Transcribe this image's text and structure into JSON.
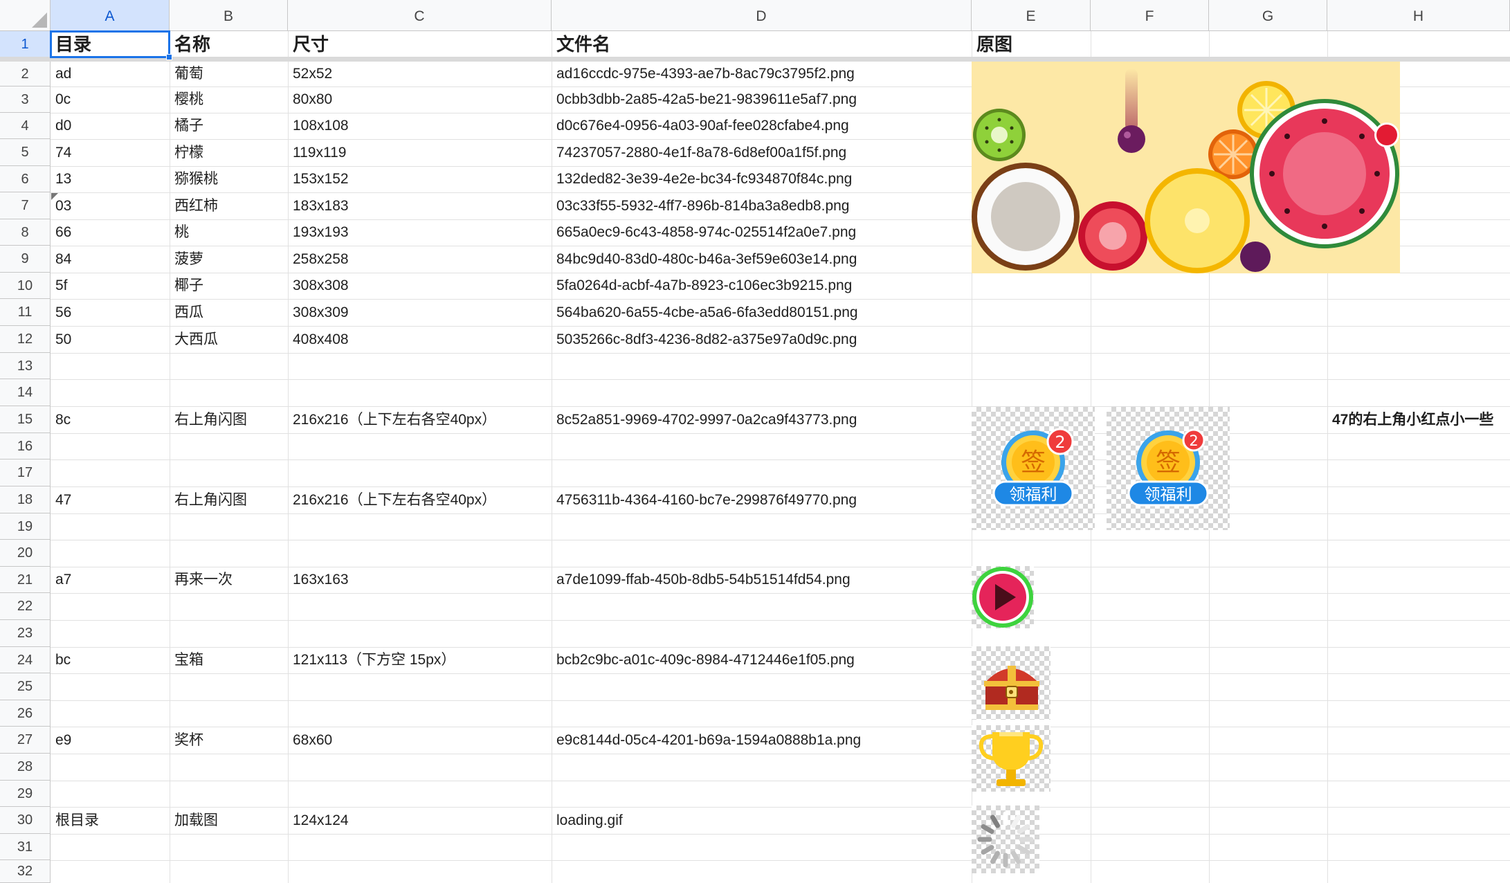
{
  "columns": [
    "A",
    "B",
    "C",
    "D",
    "E",
    "F",
    "G",
    "H"
  ],
  "rows": [
    "1",
    "2",
    "3",
    "4",
    "5",
    "6",
    "7",
    "8",
    "9",
    "10",
    "11",
    "12",
    "13",
    "14",
    "15",
    "16",
    "17",
    "18",
    "19",
    "20",
    "21",
    "22",
    "23",
    "24",
    "25",
    "26",
    "27",
    "28",
    "29",
    "30",
    "31",
    "32"
  ],
  "header": {
    "dir": "目录",
    "name": "名称",
    "size": "尺寸",
    "file": "文件名",
    "orig": "原图"
  },
  "fruits": [
    {
      "dir": "ad",
      "name": "葡萄",
      "size": "52x52",
      "file": "ad16ccdc-975e-4393-ae7b-8ac79c3795f2.png"
    },
    {
      "dir": "0c",
      "name": "樱桃",
      "size": "80x80",
      "file": "0cbb3dbb-2a85-42a5-be21-9839611e5af7.png"
    },
    {
      "dir": "d0",
      "name": "橘子",
      "size": "108x108",
      "file": "d0c676e4-0956-4a03-90af-fee028cfabe4.png"
    },
    {
      "dir": "74",
      "name": "柠檬",
      "size": "119x119",
      "file": "74237057-2880-4e1f-8a78-6d8ef00a1f5f.png"
    },
    {
      "dir": "13",
      "name": "猕猴桃",
      "size": "153x152",
      "file": "132ded82-3e39-4e2e-bc34-fc934870f84c.png"
    },
    {
      "dir": "03",
      "name": "西红柿",
      "size": "183x183",
      "file": "03c33f55-5932-4ff7-896b-814ba3a8edb8.png"
    },
    {
      "dir": "66",
      "name": "桃",
      "size": "193x193",
      "file": "665a0ec9-6c43-4858-974c-025514f2a0e7.png"
    },
    {
      "dir": "84",
      "name": "菠萝",
      "size": "258x258",
      "file": "84bc9d40-83d0-480c-b46a-3ef59e603e14.png"
    },
    {
      "dir": "5f",
      "name": "椰子",
      "size": "308x308",
      "file": "5fa0264d-acbf-4a7b-8923-c106ec3b9215.png"
    },
    {
      "dir": "56",
      "name": "西瓜",
      "size": "308x309",
      "file": "564ba620-6a55-4cbe-a5a6-6fa3edd80151.png"
    },
    {
      "dir": "50",
      "name": "大西瓜",
      "size": "408x408",
      "file": "5035266c-8df3-4236-8d82-a375e97a0d9c.png"
    }
  ],
  "assets": {
    "signin_a": {
      "dir": "8c",
      "name": "右上角闪图",
      "size": "216x216（上下左右各空40px）",
      "file": "8c52a851-9969-4702-9997-0a2ca9f43773.png"
    },
    "signin_b": {
      "dir": "47",
      "name": "右上角闪图",
      "size": "216x216（上下左右各空40px）",
      "file": "4756311b-4364-4160-bc7e-299876f49770.png"
    },
    "replay": {
      "dir": "a7",
      "name": "再来一次",
      "size": "163x163",
      "file": "a7de1099-ffab-450b-8db5-54b51514fd54.png"
    },
    "chest": {
      "dir": "bc",
      "name": "宝箱",
      "size": "121x113（下方空 15px）",
      "file": "bcb2c9bc-a01c-409c-8984-4712446e1f05.png"
    },
    "trophy": {
      "dir": "e9",
      "name": "奖杯",
      "size": "68x60",
      "file": "e9c8144d-05c4-4201-b69a-1594a0888b1a.png"
    },
    "loading": {
      "dir": "根目录",
      "name": "加载图",
      "size": "124x124",
      "file": "loading.gif"
    }
  },
  "note_h15": "47的右上角小红点小一些",
  "badge": {
    "count": "2",
    "char": "签",
    "label": "领福利"
  },
  "colors": {
    "selection": "#1a73e8",
    "header_bg": "#f8f9fa",
    "grid": "#e1e1e1",
    "fruit_bg": "#fde8a6"
  }
}
